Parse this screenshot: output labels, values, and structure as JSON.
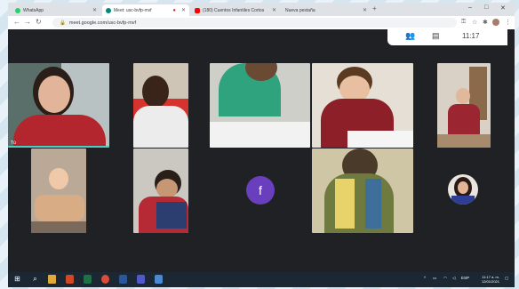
{
  "browser": {
    "tabs": [
      {
        "label": "WhatsApp",
        "color": "#25d366"
      },
      {
        "label": "Meet: usc-bvfp-mvf",
        "color": "#00897b"
      },
      {
        "label": "(180) Cuentos Infantiles Cortos",
        "color": "#ff0000"
      },
      {
        "label": "Nueva pestaña",
        "color": "#bdc1c6"
      }
    ],
    "url": "meet.google.com/usc-bvfp-mvf",
    "window_controls": {
      "minimize": "–",
      "maximize": "□",
      "close": "✕"
    }
  },
  "meet": {
    "clock": "11:17",
    "participant_initial": "f",
    "self_label": "Tú"
  },
  "taskbar": {
    "lang": "ESP",
    "time": "11:17 a. m.",
    "date": "12/01/2021"
  },
  "colors": {
    "meet_bg": "#202124",
    "avatar_purple": "#6a3fbe",
    "speaking_bar": "#4ecdc4",
    "taskbar": "#1b2733"
  }
}
